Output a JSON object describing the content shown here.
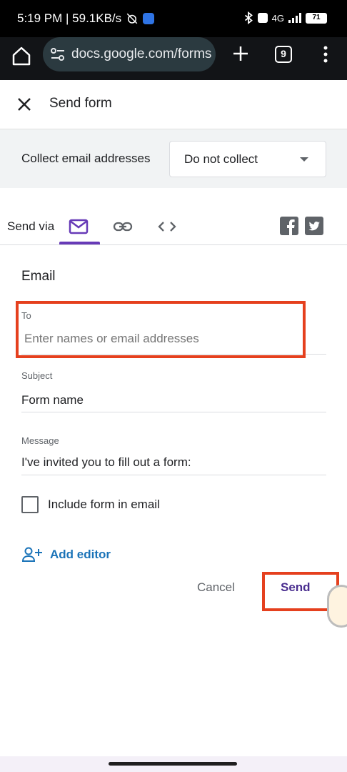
{
  "status_bar": {
    "time_speed": "5:19 PM | 59.1KB/s",
    "network": "4G",
    "battery": "71"
  },
  "browser": {
    "url": "docs.google.com/forms",
    "tab_count": "9"
  },
  "dialog": {
    "title": "Send form"
  },
  "collect": {
    "label": "Collect email addresses",
    "selected": "Do not collect"
  },
  "send_via": {
    "label": "Send via",
    "active_tab": "email"
  },
  "email": {
    "heading": "Email",
    "to_label": "To",
    "to_placeholder": "Enter names or email addresses",
    "subject_label": "Subject",
    "subject_value": "Form name",
    "message_label": "Message",
    "message_value": "I've invited you to fill out a form:",
    "include_form_label": "Include form in email",
    "include_form_checked": false,
    "add_editor_label": "Add editor"
  },
  "actions": {
    "cancel_label": "Cancel",
    "send_label": "Send"
  },
  "colors": {
    "accent": "#673ab7",
    "highlight": "#e5401e",
    "link": "#1a73b8"
  }
}
